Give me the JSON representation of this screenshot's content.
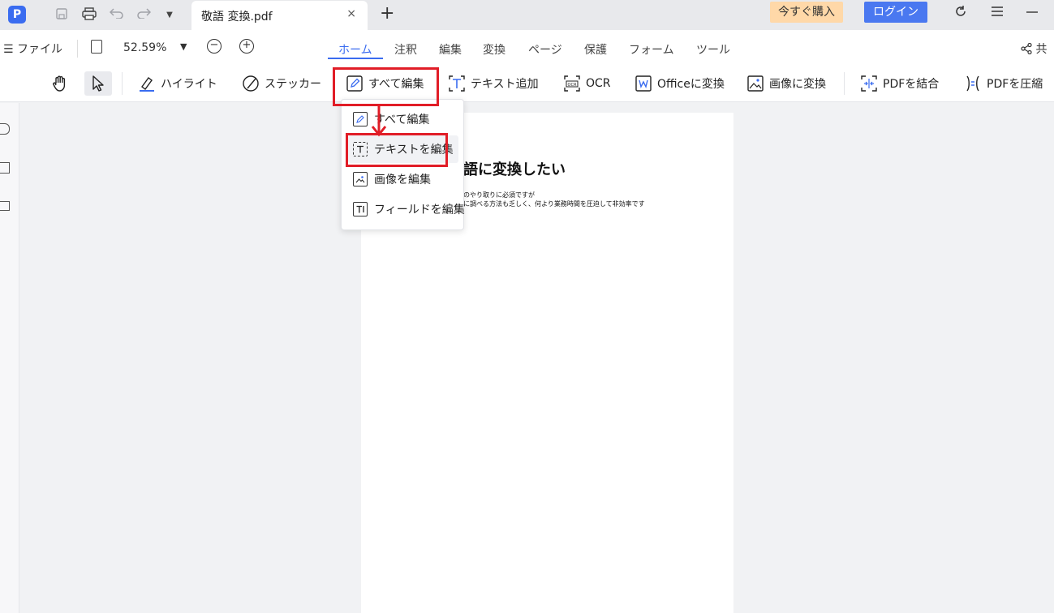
{
  "titlebar": {
    "logo_text": "P",
    "tab_title": "敬語 変換.pdf",
    "tab_close": "×",
    "new_tab": "+",
    "buy_label": "今すぐ購入",
    "login_label": "ログイン",
    "quick_access": [
      "save-icon",
      "print-icon",
      "undo-icon",
      "redo-icon",
      "more-dropdown-icon"
    ],
    "window_controls": [
      "refresh-icon",
      "menu-icon",
      "minimize-icon"
    ]
  },
  "menubar": {
    "file_label": "ファイル",
    "zoom_value": "52.59%",
    "tabs": [
      {
        "label": "ホーム",
        "active": true
      },
      {
        "label": "注釈",
        "active": false
      },
      {
        "label": "編集",
        "active": false
      },
      {
        "label": "変換",
        "active": false
      },
      {
        "label": "ページ",
        "active": false
      },
      {
        "label": "保護",
        "active": false
      },
      {
        "label": "フォーム",
        "active": false
      },
      {
        "label": "ツール",
        "active": false
      }
    ],
    "share_label": "共"
  },
  "toolbar": {
    "highlight": "ハイライト",
    "sticker": "ステッカー",
    "edit_all": "すべて編集",
    "add_text": "テキスト追加",
    "ocr": "OCR",
    "to_office": "Officeに変換",
    "to_image": "画像に変換",
    "merge_pdf": "PDFを結合",
    "compress_pdf": "PDFを圧縮"
  },
  "dropdown": {
    "items": [
      {
        "label": "すべて編集",
        "icon": "edit-all-icon"
      },
      {
        "label": "テキストを編集",
        "icon": "edit-text-icon"
      },
      {
        "label": "画像を編集",
        "icon": "edit-image-icon"
      },
      {
        "label": "フィールドを編集",
        "icon": "edit-field-icon"
      }
    ]
  },
  "document": {
    "title": "語に変換したい",
    "line1": "のやり取りに必須ですが",
    "line2": "に調べる方法も乏しく、何より業務時間を圧迫して非効率です"
  },
  "colors": {
    "accent": "#3a6cf0",
    "highlight_box": "#e11d27",
    "buy_button": "#ffd8a8"
  }
}
